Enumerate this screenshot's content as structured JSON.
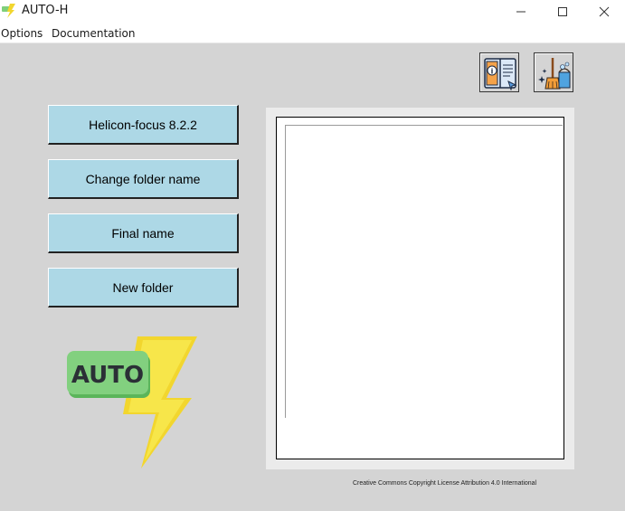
{
  "window": {
    "title": "AUTO-H"
  },
  "menu": {
    "items": [
      "Options",
      "Documentation"
    ]
  },
  "toolbar": {
    "documentation_icon": "info-book-icon",
    "clean_icon": "broom-bucket-icon"
  },
  "actions": {
    "helicon": "Helicon-focus 8.2.2",
    "change_folder": "Change folder name",
    "final_name": "Final name",
    "new_folder": "New folder"
  },
  "logo": {
    "text": "AUTO"
  },
  "log": {
    "content": ""
  },
  "footer": {
    "license": "Creative Commons Copyright License Attribution 4.0 International"
  },
  "colors": {
    "button_bg": "#add8e6",
    "window_bg": "#d4d4d4",
    "logo_green": "#7fcf7a",
    "logo_yellow": "#f7e64a"
  }
}
